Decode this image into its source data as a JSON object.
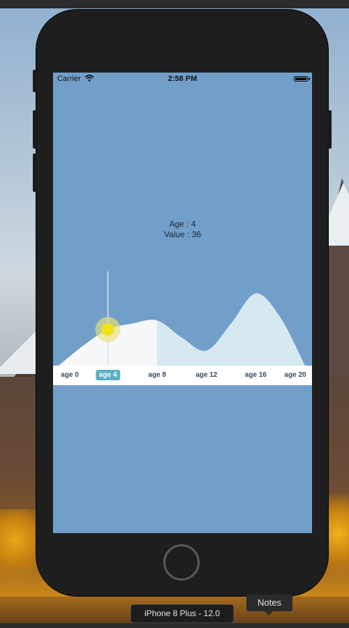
{
  "status_bar": {
    "carrier": "Carrier",
    "time": "2:58 PM"
  },
  "readout": {
    "age_line": "Age : 4",
    "value_line": "Value : 36"
  },
  "chart_data": {
    "type": "area",
    "x": [
      0,
      2,
      4,
      6,
      8,
      10,
      12,
      14,
      16,
      18,
      20
    ],
    "values": [
      0,
      20,
      36,
      42,
      45,
      28,
      15,
      42,
      72,
      48,
      0
    ],
    "tick_labels": [
      "age 0",
      "age 4",
      "age 8",
      "age 12",
      "age 16",
      "age 20"
    ],
    "selected_label": "age 4",
    "xlim": [
      0,
      20
    ],
    "ylim": [
      0,
      80
    ],
    "selected_x": 4,
    "split_x": 8,
    "colors": {
      "background": "#729fca",
      "left_area": "#f6f7f8",
      "right_area": "#d7e9f0",
      "marker": "#f5e11a",
      "marker_halo": "#e9e27a",
      "axis_text": "#2f4a66",
      "selected_tick_bg": "#5bb0c4"
    }
  },
  "simulator": {
    "device_label": "iPhone 8 Plus - 12.0",
    "tooltip": "Notes"
  },
  "icons": {
    "wifi": "wifi-icon",
    "battery": "battery-icon",
    "home": "home-button"
  }
}
